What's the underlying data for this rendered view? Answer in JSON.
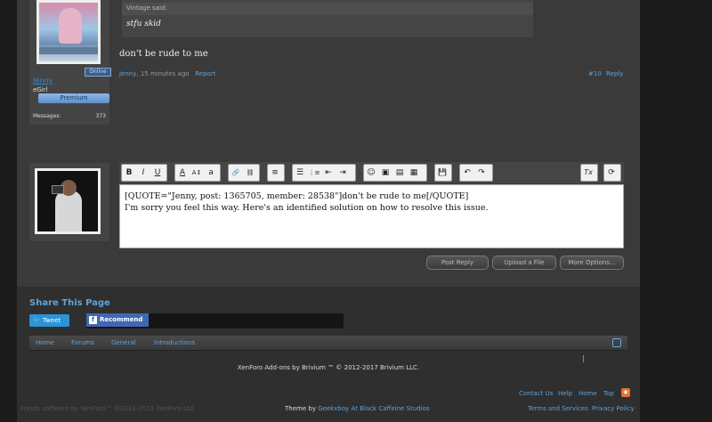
{
  "post": {
    "user": {
      "name": "Jenny",
      "title": "eGirl",
      "online_badge": "Online",
      "banner": "Premium",
      "messages_label": "Messages:",
      "messages_count": "373"
    },
    "quote": {
      "header": "Vintage said:",
      "text": "stfu skid"
    },
    "text": "don't be rude to me",
    "meta": {
      "author": "Jenny",
      "time": "15 minutes ago",
      "report": "Report"
    },
    "number": "#10",
    "reply": "Reply"
  },
  "editor": {
    "toolbar": [
      "B",
      "I",
      "U",
      "A",
      "A↕",
      "a",
      "🔗",
      "⛓",
      "≡",
      "☰",
      "⋮≡",
      "⇤",
      "⇥",
      "☺",
      "▣",
      "▤",
      "▦",
      "💾",
      "↶",
      "↷",
      "Tx",
      "⟳"
    ],
    "content_line1": "[QUOTE=\"Jenny, post: 1365705, member: 28538\"]don't be rude to me[/QUOTE]",
    "content_line2": "I'm sorry you feel this way. Here's an identified solution on how to resolve this issue."
  },
  "actions": {
    "post_reply": "Post Reply",
    "upload": "Upload a File",
    "more": "More Options..."
  },
  "share": {
    "title": "Share This Page",
    "tweet": "Tweet",
    "recommend": "Recommend"
  },
  "breadcrumbs": [
    "Home",
    "Forums",
    "General",
    "Introductions"
  ],
  "footer": {
    "copyright": "XenForo Add-ons by Brivium ™ © 2012-2017 Brivium LLC.",
    "links": [
      "Contact Us",
      "Help",
      "Home",
      "Top"
    ],
    "forum_software": "Forum software by XenForo™ ©2010-2015 XenForo Ltd.",
    "theme_prefix": "Theme by",
    "theme_link": "Geekxboy At Black Caffeine Studios",
    "terms": "Terms and Services",
    "privacy": "Privacy Policy"
  }
}
